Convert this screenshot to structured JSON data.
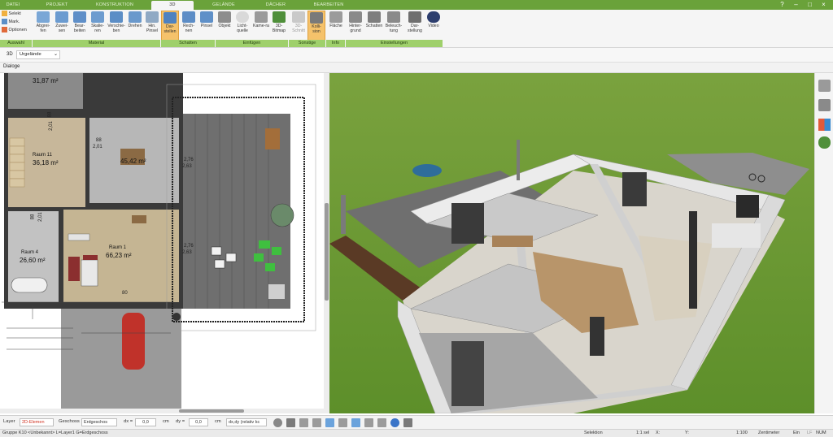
{
  "tabs": [
    "DATEI",
    "PROJEKT",
    "KONSTRUKTION",
    "3D",
    "GELÄNDE",
    "DÄCHER",
    "BEARBEITEN"
  ],
  "window_controls": [
    "?",
    "–",
    "□",
    "×"
  ],
  "ribbon": {
    "select": {
      "selekt": "Selekt",
      "mark": "Mark.",
      "optionen": "Optionen"
    },
    "buttons": [
      {
        "label": "Abgrei-fen"
      },
      {
        "label": "Zuwei-sen"
      },
      {
        "label": "Bear-beiten"
      },
      {
        "label": "Skalie-ren"
      },
      {
        "label": "Verschie-ben"
      },
      {
        "label": "Drehen"
      },
      {
        "label": "Hin. Pinsel"
      },
      {
        "label": "Dar-stellen"
      },
      {
        "label": "Rech-nen"
      },
      {
        "label": "Pinsel"
      },
      {
        "label": "Objekt"
      },
      {
        "label": "Licht-quelle"
      },
      {
        "label": "Kame-ra"
      },
      {
        "label": "3D-Bitmap"
      },
      {
        "label": "3D-Schnitt"
      },
      {
        "label": "Kolli-sion"
      },
      {
        "label": "Fläche"
      },
      {
        "label": "Hinter-grund"
      },
      {
        "label": "Schatten"
      },
      {
        "label": "Beleuch-tung"
      },
      {
        "label": "Dar-stellung"
      },
      {
        "label": "Video"
      }
    ],
    "groups": [
      "Auswahl",
      "Material",
      "Schatten",
      "Einfügen",
      "Sonstige",
      "Info",
      "Einstellungen"
    ]
  },
  "viewbar": {
    "mode": "3D",
    "terrain": "Urgelände"
  },
  "dialog_label": "Dialoge",
  "plan": {
    "rooms": [
      {
        "name": "",
        "area": "31,87 m²"
      },
      {
        "name": "Raum 11",
        "area": "36,18 m²"
      },
      {
        "name": "",
        "area": "45,42 m²"
      },
      {
        "name": "Raum 4",
        "area": "26,60 m²"
      },
      {
        "name": "Raum 1",
        "area": "66,23 m²"
      }
    ],
    "dims": [
      "88",
      "2,01",
      "88",
      "2,01",
      "2,76",
      "2,63",
      "2,76",
      "2,63",
      "88",
      "2,01",
      "80"
    ]
  },
  "propbar": {
    "layer_label": "Layer",
    "layer_value": "2D-Elemen",
    "geschoss_label": "Geschoss",
    "geschoss_value": "Erdgeschos",
    "dx_label": "dx =",
    "dx_value": "0,0",
    "dx_unit": "cm",
    "dy_label": "dy =",
    "dy_value": "0,0",
    "dy_unit": "cm",
    "rel_value": "dx,dy (relativ kc"
  },
  "status": {
    "group": "Gruppe K10 <Unbekannt> L=Layer1 G=Erdgeschoss",
    "mode": "Selektion",
    "sel": "1:1 sel",
    "x": "X:",
    "y": "Y:",
    "scale": "1:100",
    "unit": "Zentimeter",
    "ein": "Ein",
    "lf": "LF",
    "num": "NUM"
  },
  "colors": {
    "tab_green": "#6aa23a",
    "group_green": "#9fd06b",
    "selected_orange": "#f5c26b",
    "grass": "#6a9a2e"
  }
}
